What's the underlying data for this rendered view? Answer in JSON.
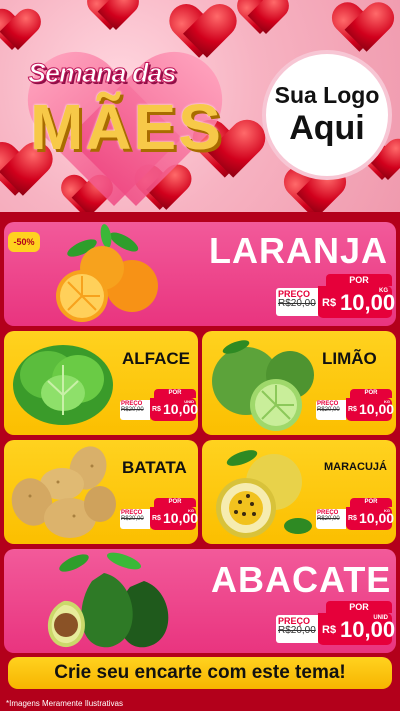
{
  "header": {
    "title_top": "Semana das",
    "title_main": "MÃES",
    "logo_line1": "Sua Logo",
    "logo_line2": "Aqui"
  },
  "badge": "-50%",
  "products": [
    {
      "name": "LARANJA",
      "por": "POR",
      "preco": "PREÇO",
      "old": "R$20,00",
      "currency": "R$",
      "price": "10,00",
      "unit": "KG",
      "icon": "orange-icon"
    },
    {
      "name": "ALFACE",
      "por": "POR",
      "preco": "PREÇO",
      "old": "R$20,00",
      "currency": "R$",
      "price": "10,00",
      "unit": "UNID",
      "icon": "lettuce-icon"
    },
    {
      "name": "LIMÃO",
      "por": "POR",
      "preco": "PREÇO",
      "old": "R$20,00",
      "currency": "R$",
      "price": "10,00",
      "unit": "KG",
      "icon": "lime-icon"
    },
    {
      "name": "BATATA",
      "por": "POR",
      "preco": "PREÇO",
      "old": "R$20,00",
      "currency": "R$",
      "price": "10,00",
      "unit": "KG",
      "icon": "potato-icon"
    },
    {
      "name": "MARACUJÁ",
      "por": "POR",
      "preco": "PREÇO",
      "old": "R$20,00",
      "currency": "R$",
      "price": "10,00",
      "unit": "KG",
      "icon": "passion-fruit-icon"
    },
    {
      "name": "ABACATE",
      "por": "POR",
      "preco": "PREÇO",
      "old": "R$20,00",
      "currency": "R$",
      "price": "10,00",
      "unit": "UNID",
      "icon": "avocado-icon"
    }
  ],
  "cta": "Crie seu encarte com este tema!",
  "footnote": "*Imagens Meramente Ilustrativas",
  "colors": {
    "pink": "#e9347f",
    "yellow": "#fbbf00",
    "red": "#e6003a",
    "background": "#b3001b"
  }
}
